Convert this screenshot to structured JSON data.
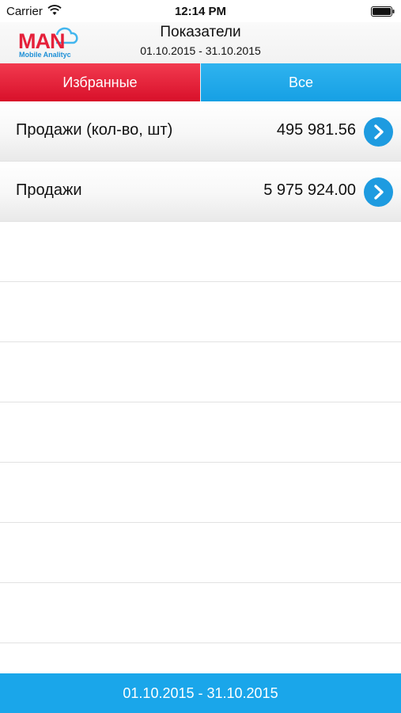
{
  "status_bar": {
    "carrier": "Carrier",
    "time": "12:14 PM",
    "wifi_icon": "wifi-icon",
    "battery_icon": "battery-icon"
  },
  "header": {
    "logo_text": "MAN",
    "logo_subtext": "Mobile Analityc",
    "title": "Показатели",
    "period": "01.10.2015 - 31.10.2015"
  },
  "tabs": [
    {
      "label": "Избранные",
      "color": "#e5203a",
      "selected": true
    },
    {
      "label": "Все",
      "color": "#22aaeb",
      "selected": false
    }
  ],
  "rows": [
    {
      "label": "Продажи (кол-во, шт)",
      "value": "495 981.56",
      "icon": "chevron-right-icon"
    },
    {
      "label": "Продажи",
      "value": "5 975 924.00",
      "icon": "chevron-right-icon"
    }
  ],
  "footer": {
    "period_button": "01.10.2015 - 31.10.2015"
  },
  "colors": {
    "accent_blue": "#1aa6ea",
    "accent_red": "#e5203a"
  }
}
